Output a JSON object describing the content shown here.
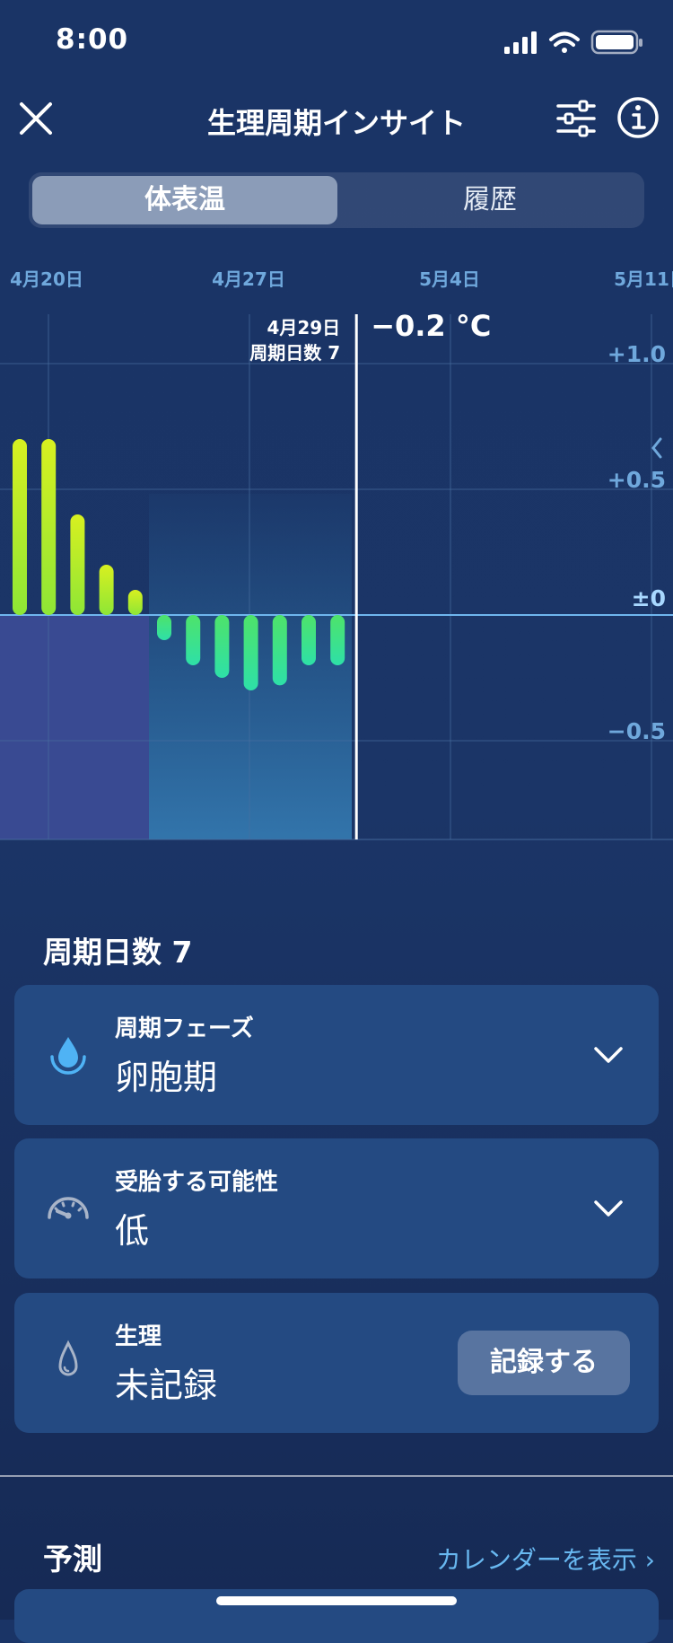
{
  "status": {
    "time": "8:00"
  },
  "nav": {
    "title": "生理周期インサイト"
  },
  "tabs": [
    {
      "label": "体表温",
      "active": true
    },
    {
      "label": "履歴",
      "active": false
    }
  ],
  "chart_data": {
    "type": "bar",
    "x_tick_labels": [
      "4月20日",
      "4月27日",
      "5月4日",
      "5月11日"
    ],
    "y_tick_labels": [
      "+1.0",
      "+0.5",
      "±0",
      "−0.5"
    ],
    "ylim": [
      -0.9,
      1.1
    ],
    "grid": true,
    "values": [
      0.7,
      0.7,
      0.4,
      0.2,
      0.1,
      -0.1,
      -0.2,
      -0.25,
      -0.3,
      -0.28,
      -0.2,
      -0.2
    ],
    "selected": {
      "date_label": "4月29日",
      "cycle_label": "周期日数 7",
      "value_label": "−0.2 °C",
      "index": 11
    },
    "period_marker_count": 3,
    "colors": {
      "positive": "#b8f024",
      "negative": "#2ee0a0",
      "axis_label": "#6fa8dc",
      "zero_label": "#a8d8ff"
    }
  },
  "day": {
    "title": "周期日数 7"
  },
  "cards": {
    "phase": {
      "label": "周期フェーズ",
      "value": "卵胞期",
      "icon": "drop-filled-icon"
    },
    "fertility": {
      "label": "受胎する可能性",
      "value": "低",
      "icon": "gauge-icon"
    },
    "period": {
      "label": "生理",
      "value": "未記録",
      "button": "記録する",
      "icon": "drop-outline-icon"
    }
  },
  "forecast": {
    "title": "予測",
    "link": "カレンダーを表示"
  }
}
